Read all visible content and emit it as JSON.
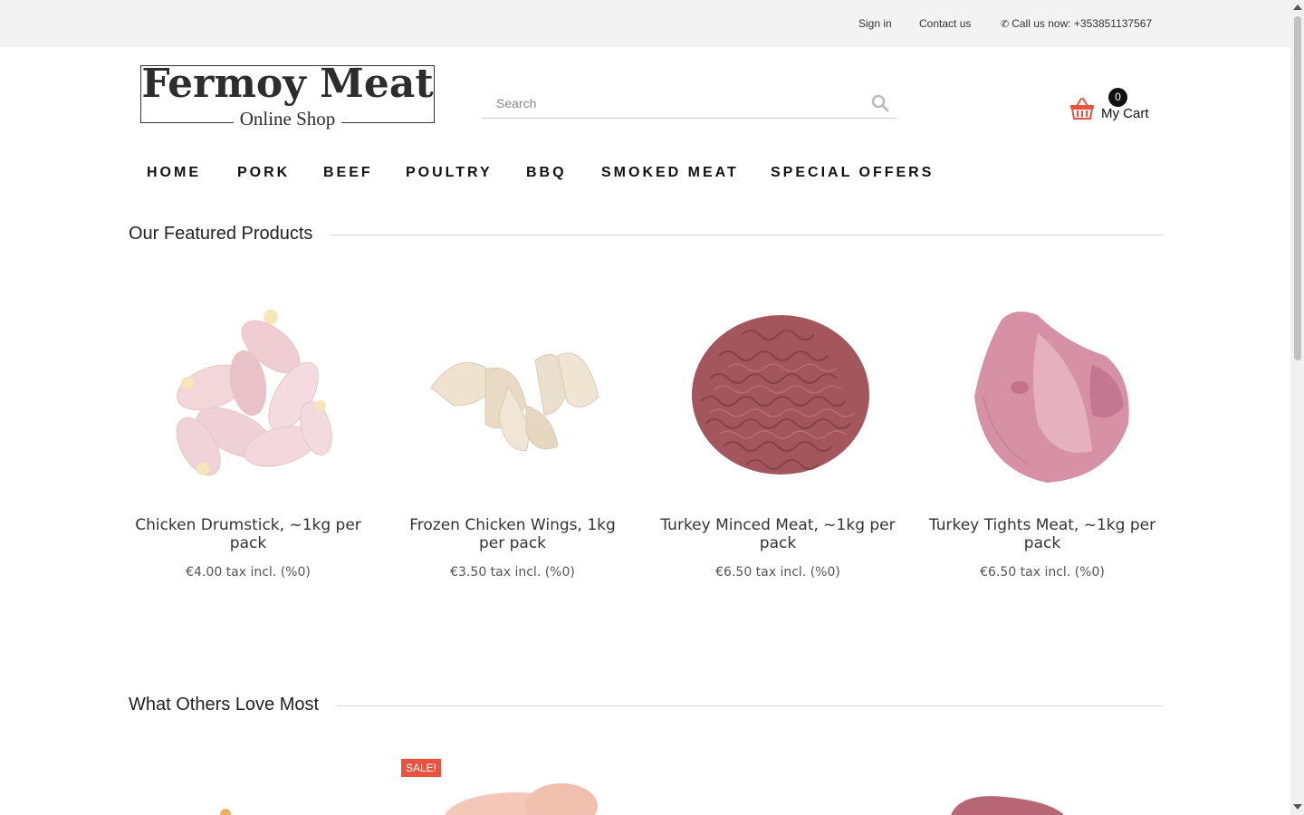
{
  "topbar": {
    "sign_in": "Sign in",
    "contact": "Contact us",
    "phone": "Call us now: +353851137567"
  },
  "logo": {
    "title": "Fermoy Meat",
    "subtitle": "Online Shop"
  },
  "search": {
    "placeholder": "Search"
  },
  "cart": {
    "count": "0",
    "label": "My Cart"
  },
  "nav": [
    "HOME",
    "PORK",
    "BEEF",
    "POULTRY",
    "BBQ",
    "SMOKED MEAT",
    "SPECIAL OFFERS"
  ],
  "featured": {
    "title": "Our Featured Products",
    "products": [
      {
        "name": "Chicken Drumstick, ~1kg per pack",
        "price": "€4.00 tax incl. (%0)"
      },
      {
        "name": "Frozen Chicken Wings, 1kg per pack",
        "price": "€3.50 tax incl. (%0)"
      },
      {
        "name": "Turkey Minced Meat, ~1kg per pack",
        "price": "€6.50 tax incl. (%0)"
      },
      {
        "name": "Turkey Tights Meat, ~1kg per pack",
        "price": "€6.50 tax incl. (%0)"
      }
    ]
  },
  "popular": {
    "title": "What Others Love Most",
    "sale_badge": "SALE!"
  },
  "colors": {
    "accent_cart": "#e8533f",
    "sale_badge": "#e8533f",
    "topbar_bg": "#f3f3f3"
  }
}
